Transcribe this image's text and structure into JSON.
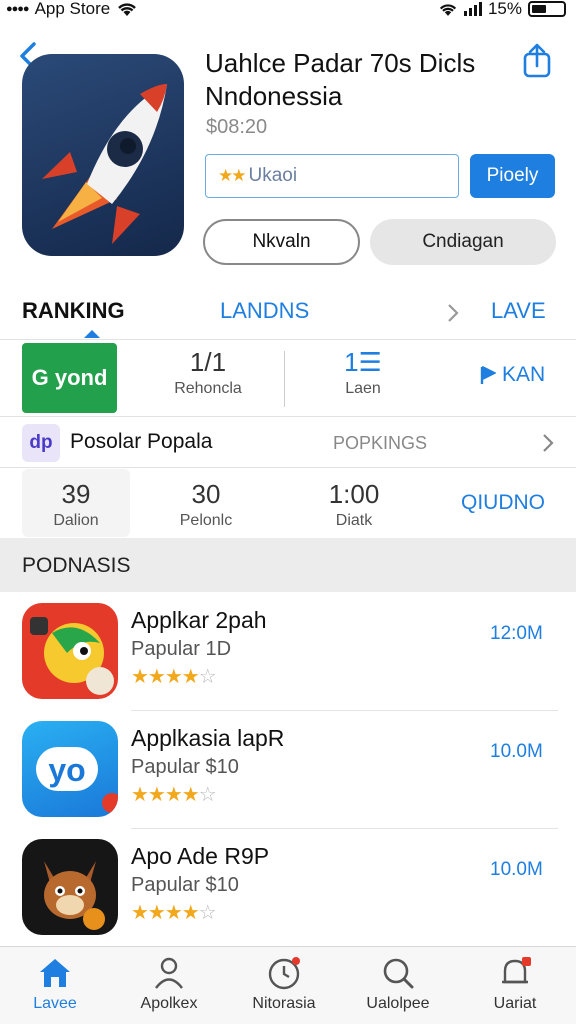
{
  "status_bar": {
    "carrier": "App Store",
    "battery": "15%"
  },
  "app": {
    "title": "Uahlce Padar 70s Dicls Nndonessia",
    "price": "$08:20",
    "rating_label": "Ukaoi",
    "primary_button": "Pioely",
    "secondary_button": "Nkvaln",
    "tertiary_button": "Cndiagan"
  },
  "tabs": {
    "ranking": "RANKING",
    "landns": "LANDNS",
    "lave": "LAVE"
  },
  "stats_row_1": {
    "badge": "G yond",
    "stat_a_value": "1/1",
    "stat_a_label": "Rehoncla",
    "stat_b_value": "1☰",
    "stat_b_label": "Laen",
    "link": "KAN"
  },
  "row_2": {
    "icon_text": "dp",
    "title": "Posolar Popala",
    "link": "POPKINGS"
  },
  "stats_row_2": {
    "a_value": "39",
    "a_label": "Dalion",
    "b_value": "30",
    "b_label": "Pelonlc",
    "c_value": "1:00",
    "c_label": "Diatk",
    "link": "QIUDNO"
  },
  "section": {
    "title": "PODNASIS"
  },
  "list": [
    {
      "title": "Applkar 2pah",
      "subtitle": "Papular  1D",
      "rating": 4,
      "size": "12:0M"
    },
    {
      "title": "Applkasia lapR",
      "subtitle": "Papular  $10",
      "rating": 4,
      "size": "10.0M"
    },
    {
      "title": "Apo Ade R9P",
      "subtitle": "Papular  $10",
      "rating": 4,
      "size": "10.0M"
    }
  ],
  "tab_bar": {
    "items": [
      {
        "label": "Lavee",
        "icon": "home-icon"
      },
      {
        "label": "Apolkex",
        "icon": "person-icon"
      },
      {
        "label": "Nitorasia",
        "icon": "timer-icon"
      },
      {
        "label": "Ualolpee",
        "icon": "search-icon"
      },
      {
        "label": "Uariat",
        "icon": "bell-icon"
      }
    ]
  },
  "colors": {
    "accent": "#1f7fe0",
    "star": "#f2a81d",
    "badge_green": "#22a04c"
  }
}
